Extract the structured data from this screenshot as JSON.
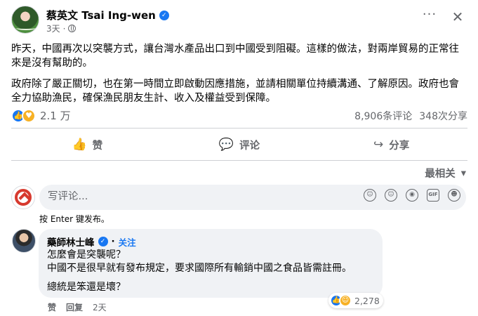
{
  "post": {
    "author": "蔡英文 Tsai Ing-wen",
    "time": "3天",
    "more": "···",
    "close": "✕",
    "paragraph1": "昨天，中國再次以突襲方式，讓台灣水產品出口到中國受到阻礙。這樣的做法，對兩岸貿易的正常往來是沒有幫助的。",
    "paragraph2": "政府除了嚴正關切，也在第一時間立即啟動因應措施，並請相關單位持續溝通、了解原因。政府也會全力協助漁民，確保漁民朋友生計、收入及權益受到保障。"
  },
  "stats": {
    "reactions": "2.1 万",
    "comments": "8,906条评论",
    "shares": "348次分享"
  },
  "actions": {
    "like": "赞",
    "comment": "评论",
    "share": "分享"
  },
  "sort": {
    "label": "最相关",
    "chevron": "▾"
  },
  "composer": {
    "placeholder": "写评论...",
    "hint": "按 Enter 键发布。",
    "tools": [
      "☺",
      "☺",
      "◉",
      "GIF",
      "☻"
    ]
  },
  "comment": {
    "author": "藥師林士峰",
    "follow": "关注",
    "line1": "怎麼會是突襲呢？",
    "line2": "中國不是很早就有發布規定，要求國際所有輸銷中國之食品皆需註冊。",
    "line3": "總統是笨還是壞？",
    "like": "赞",
    "reply": "回复",
    "time": "2天",
    "reactions": "2,278"
  },
  "colors": {
    "accent": "#1877f2",
    "secondary_text": "#65676b",
    "bubble": "#f0f2f5"
  }
}
